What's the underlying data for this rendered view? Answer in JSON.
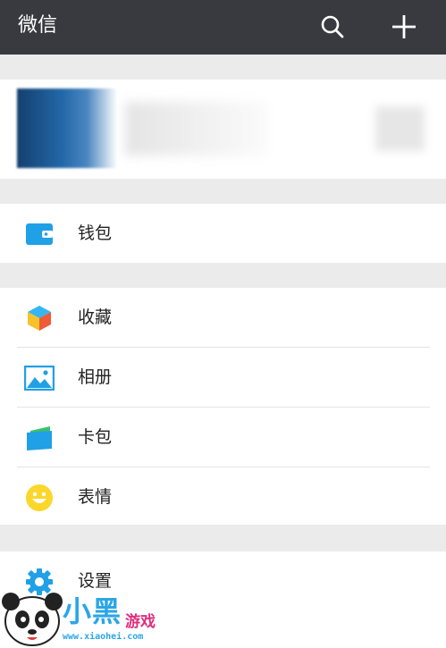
{
  "header": {
    "title": "微信",
    "search_icon": "search-icon",
    "add_icon": "plus-icon"
  },
  "wallet": {
    "label": "钱包",
    "icon": "wallet-icon",
    "color": "#20a0e6"
  },
  "menu": [
    {
      "label": "收藏",
      "icon": "favorites-cube-icon"
    },
    {
      "label": "相册",
      "icon": "album-icon"
    },
    {
      "label": "卡包",
      "icon": "card-wallet-icon"
    },
    {
      "label": "表情",
      "icon": "emoji-smile-icon"
    }
  ],
  "settings": {
    "label": "设置",
    "icon": "gear-icon"
  },
  "watermark": {
    "title": "小黑",
    "subtitle": "游戏",
    "url": "www.xiaohei.com"
  },
  "colors": {
    "header_bg": "#393a3f",
    "page_bg": "#ebebeb",
    "accent_blue": "#20a0e6"
  }
}
